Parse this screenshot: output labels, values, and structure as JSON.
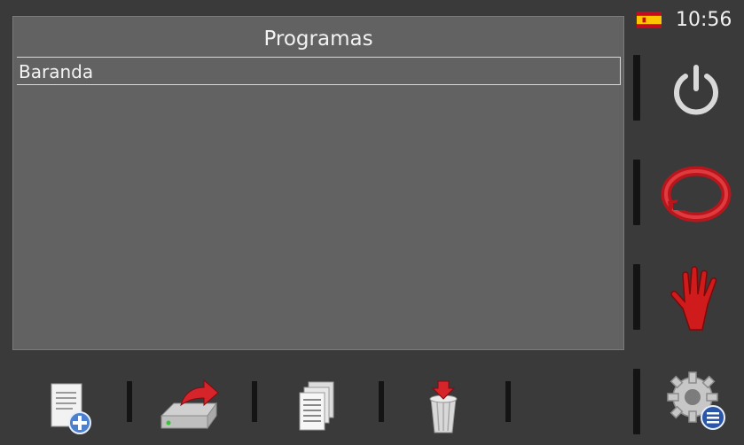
{
  "status": {
    "time": "10:56",
    "language_flag": "spain-flag-icon"
  },
  "panel": {
    "title": "Programas",
    "items": [
      {
        "label": "Baranda",
        "selected": true
      }
    ]
  },
  "sidebar": {
    "buttons": [
      {
        "name": "power-icon"
      },
      {
        "name": "restart-icon"
      },
      {
        "name": "stop-hand-icon"
      },
      {
        "name": "settings-gear-icon"
      }
    ]
  },
  "toolbar": {
    "buttons": [
      {
        "name": "new-program-icon"
      },
      {
        "name": "load-program-icon"
      },
      {
        "name": "copy-program-icon"
      },
      {
        "name": "delete-program-icon"
      }
    ]
  },
  "colors": {
    "panel_bg": "#626262",
    "app_bg": "#3a3a3a",
    "accent_red": "#c8141b"
  }
}
